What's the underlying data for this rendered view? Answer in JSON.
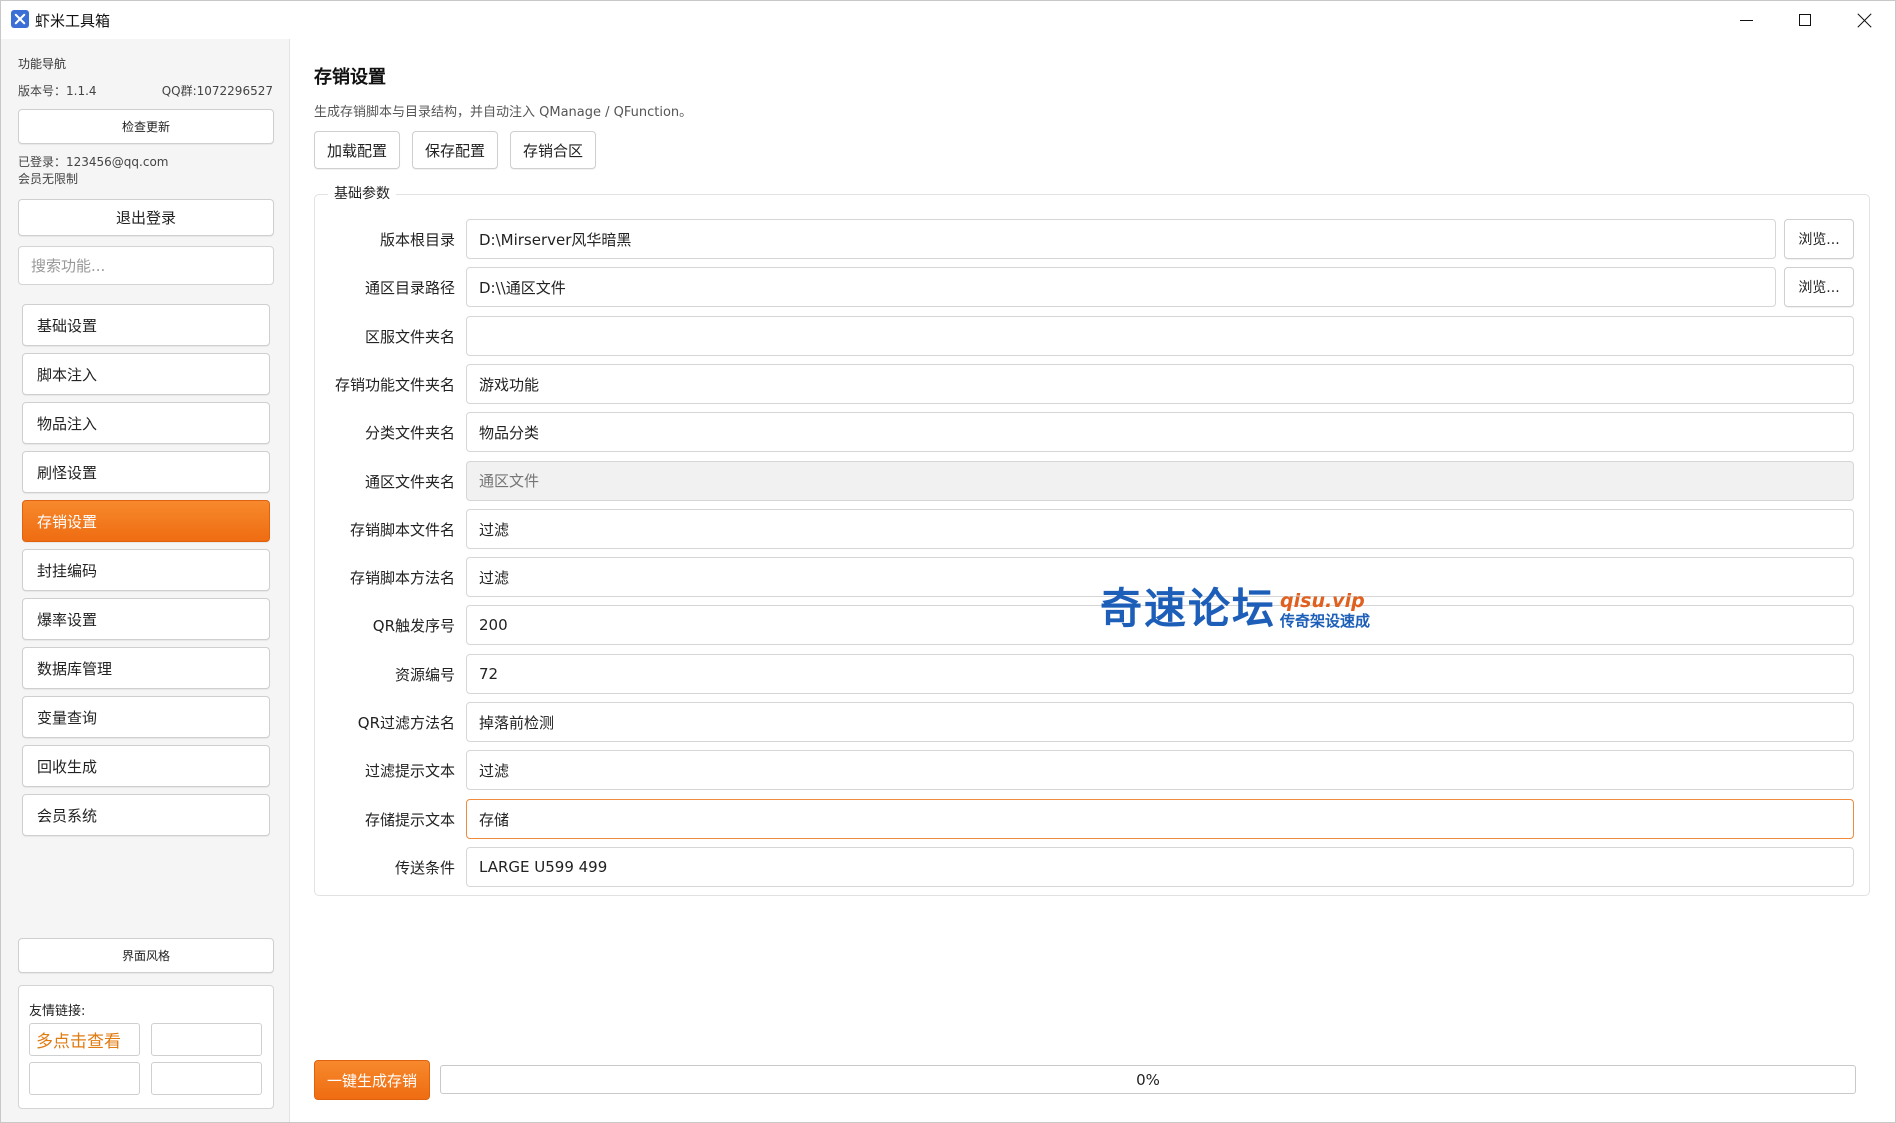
{
  "window": {
    "title": "虾米工具箱"
  },
  "sidebar": {
    "heading": "功能导航",
    "version": "版本号：1.1.4",
    "qq": "QQ群:1072296527",
    "check_update": "检查更新",
    "login_user": "已登录：123456@qq.com",
    "member_status": "会员无限制",
    "logout": "退出登录",
    "search_placeholder": "搜索功能...",
    "items": [
      {
        "label": "基础设置",
        "active": false
      },
      {
        "label": "脚本注入",
        "active": false
      },
      {
        "label": "物品注入",
        "active": false
      },
      {
        "label": "刷怪设置",
        "active": false
      },
      {
        "label": "存销设置",
        "active": true
      },
      {
        "label": "封挂编码",
        "active": false
      },
      {
        "label": "爆率设置",
        "active": false
      },
      {
        "label": "数据库管理",
        "active": false
      },
      {
        "label": "变量查询",
        "active": false
      },
      {
        "label": "回收生成",
        "active": false
      },
      {
        "label": "会员系统",
        "active": false
      }
    ],
    "theme": "界面风格",
    "links_title": "友情链接:",
    "links": [
      "多点击查看",
      "",
      "",
      ""
    ]
  },
  "main": {
    "title": "存销设置",
    "description": "生成存销脚本与目录结构，并自动注入 QManage / QFunction。",
    "toolbar": {
      "load": "加载配置",
      "save": "保存配置",
      "merge": "存销合区"
    },
    "group_title": "基础参数",
    "browse": "浏览...",
    "fields": [
      {
        "label": "版本根目录",
        "value": "D:\\Mirserver风华暗黑",
        "browse": true
      },
      {
        "label": "通区目录路径",
        "value": "D:\\\\通区文件",
        "browse": true
      },
      {
        "label": "区服文件夹名",
        "value": ""
      },
      {
        "label": "存销功能文件夹名",
        "value": "游戏功能"
      },
      {
        "label": "分类文件夹名",
        "value": "物品分类"
      },
      {
        "label": "通区文件夹名",
        "value": "",
        "placeholder": "通区文件",
        "disabled": true
      },
      {
        "label": "存销脚本文件名",
        "value": "过滤"
      },
      {
        "label": "存销脚本方法名",
        "value": "过滤"
      },
      {
        "label": "QR触发序号",
        "value": "200"
      },
      {
        "label": "资源编号",
        "value": "72"
      },
      {
        "label": "QR过滤方法名",
        "value": "掉落前检测"
      },
      {
        "label": "过滤提示文本",
        "value": "过滤"
      },
      {
        "label": "存储提示文本",
        "value": "存储",
        "focused": true
      },
      {
        "label": "传送条件",
        "value": "LARGE U599 499"
      }
    ],
    "watermark": {
      "main": "奇速论坛",
      "url": "qisu.vip",
      "sub": "传奇架设速成"
    },
    "generate": "一键生成存销",
    "progress": {
      "value": 0,
      "text": "0%"
    }
  },
  "colors": {
    "accent": "#f47a1f",
    "watermark_blue": "#1d5fb8"
  }
}
